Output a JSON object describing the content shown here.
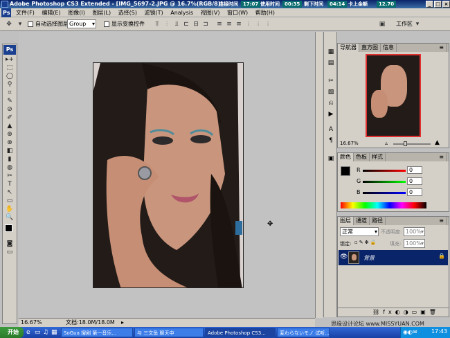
{
  "titlebar": {
    "title": "Adobe Photoshop CS3 Extended - [IMG_5697-2.JPG @ 16.7%(RGB/8)]",
    "timers": [
      {
        "label": "连接时间",
        "value": "17:07"
      },
      {
        "label": "使用时间",
        "value": "00:35"
      },
      {
        "label": "剩下时间",
        "value": "04:14"
      },
      {
        "label": "卡上金额",
        "value": "12.70"
      }
    ]
  },
  "menu": {
    "logo": "Ps",
    "items": [
      "文件(F)",
      "编辑(E)",
      "图像(I)",
      "图层(L)",
      "选择(S)",
      "滤镜(T)",
      "Analysis",
      "视图(V)",
      "窗口(W)",
      "帮助(H)"
    ]
  },
  "options": {
    "auto_select_label": "自动选择图层",
    "auto_select_value": "Group",
    "show_transform_label": "显示变换控件",
    "workspace_label": "工作区"
  },
  "toolbox": {
    "logo": "Ps",
    "tools": [
      "▸+",
      "⬚",
      "◯",
      "⚲",
      "⌗",
      "✎",
      "⊘",
      "✐",
      "▲",
      "⊕",
      "⊗",
      "◧",
      "▮",
      "◍",
      "✂",
      "T",
      "↖",
      "▭",
      "✋",
      "🔍"
    ]
  },
  "navigator": {
    "tabs": [
      "导航器",
      "直方图",
      "信息"
    ],
    "zoom": "16.67%"
  },
  "color_panel": {
    "tabs": [
      "颜色",
      "色板",
      "样式"
    ],
    "channels": [
      {
        "name": "R",
        "value": "0",
        "color": "#c00000"
      },
      {
        "name": "G",
        "value": "0",
        "color": "#008000"
      },
      {
        "name": "B",
        "value": "0",
        "color": "#0000c0"
      }
    ]
  },
  "layers_panel": {
    "tabs": [
      "图层",
      "通道",
      "路径"
    ],
    "blend_mode": "正常",
    "opacity_label": "不透明度:",
    "opacity_value": "100%",
    "lock_label": "锁定:",
    "fill_label": "填充:",
    "fill_value": "100%",
    "layer_name": "背景",
    "selected_color": "#0a246a"
  },
  "status": {
    "zoom": "16.67%",
    "doc_info": "文档:18.0M/18.0M"
  },
  "taskbar": {
    "start_label": "开始",
    "tasks": [
      "SoGua 搜剧 第一音乐...",
      "与 三文鱼 聊天中",
      "Adobe Photoshop CS3...",
      "変わらないモノ 试听..."
    ],
    "clock": "17:43"
  },
  "watermark": "思缘设计论坛 www.MISSYUAN.COM"
}
